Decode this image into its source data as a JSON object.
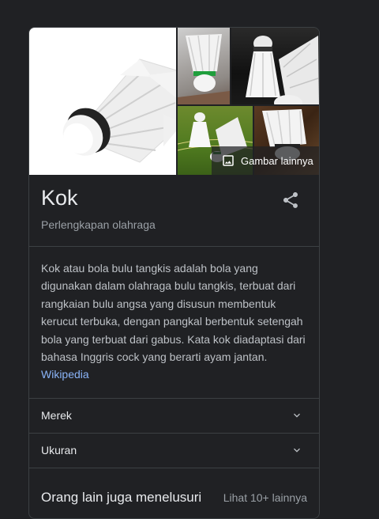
{
  "panel": {
    "title": "Kok",
    "subtitle": "Perlengkapan olahraga",
    "images_more_label": "Gambar lainnya",
    "description": "Kok atau bola bulu tangkis adalah bola yang digunakan dalam olahraga bulu tangkis, terbuat dari rangkaian bulu angsa yang disusun membentuk kerucut terbuka, dengan pangkal berbentuk setengah bola yang terbuat dari gabus. Kata kok diadaptasi dari bahasa Inggris cock yang berarti ayam jantan.",
    "source_link": "Wikipedia",
    "accordions": [
      {
        "label": "Merek"
      },
      {
        "label": "Ukuran"
      }
    ],
    "related": {
      "title": "Orang lain juga menelusuri",
      "more_link": "Lihat 10+ lainnya"
    }
  },
  "icons": {
    "share": "share-icon",
    "gallery": "image-icon",
    "expand": "chevron-down-icon"
  },
  "colors": {
    "background": "#202124",
    "border": "#3c4043",
    "link": "#8ab4f8",
    "text_secondary": "#9aa0a6"
  }
}
